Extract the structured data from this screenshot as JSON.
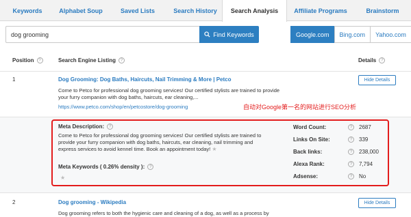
{
  "tabs": [
    {
      "label": "Keywords",
      "active": false
    },
    {
      "label": "Alphabet Soup",
      "active": false
    },
    {
      "label": "Saved Lists",
      "active": false
    },
    {
      "label": "Search History",
      "active": false
    },
    {
      "label": "Search Analysis",
      "active": true
    },
    {
      "label": "Affiliate Programs",
      "active": false
    },
    {
      "label": "Brainstorm",
      "active": false
    }
  ],
  "search": {
    "value": "dog grooming",
    "button_label": "Find Keywords",
    "engines": [
      {
        "label": "Google.com",
        "active": true
      },
      {
        "label": "Bing.com",
        "active": false
      },
      {
        "label": "Yahoo.com",
        "active": false
      }
    ]
  },
  "table": {
    "headers": {
      "position": "Position",
      "listing": "Search Engine Listing",
      "details": "Details"
    },
    "rows": [
      {
        "position": "1",
        "title": "Dog Grooming: Dog Baths, Haircuts, Nail Trimming & More | Petco",
        "description": "Come to Petco for professional dog grooming services! Our certified stylists are trained to provide your furry companion with dog baths, haircuts, ear cleaning,...",
        "url": "https://www.petco.com/shop/en/petcostore/dog-grooming",
        "button_label": "Hide Details"
      },
      {
        "position": "2",
        "title": "Dog grooming - Wikipedia",
        "description": "Dog grooming refers to both the hygienic care and cleaning of a dog, as well as a process by",
        "button_label": "Hide Details"
      }
    ]
  },
  "annotation": "自动对Google第一名的网站进行SEO分析",
  "details": {
    "meta_description_label": "Meta Description:",
    "meta_description": "Come to Petco for professional dog grooming services! Our certified stylists are trained to provide your furry companion with dog baths, haircuts, ear cleaning, nail trimming and express services to avoid kennel time. Book an appointment today!",
    "meta_keywords_label": "Meta Keywords ( 0.26% density ):",
    "stats": [
      {
        "label": "Word Count:",
        "value": "2687"
      },
      {
        "label": "Links On Site:",
        "value": "339"
      },
      {
        "label": "Back links:",
        "value": "238,000"
      },
      {
        "label": "Alexa Rank:",
        "value": "7,794"
      },
      {
        "label": "Adsense:",
        "value": "No"
      }
    ]
  },
  "colors": {
    "accent": "#2d7fc1",
    "link": "#2a7bc0",
    "annotation": "#e31b1b"
  }
}
